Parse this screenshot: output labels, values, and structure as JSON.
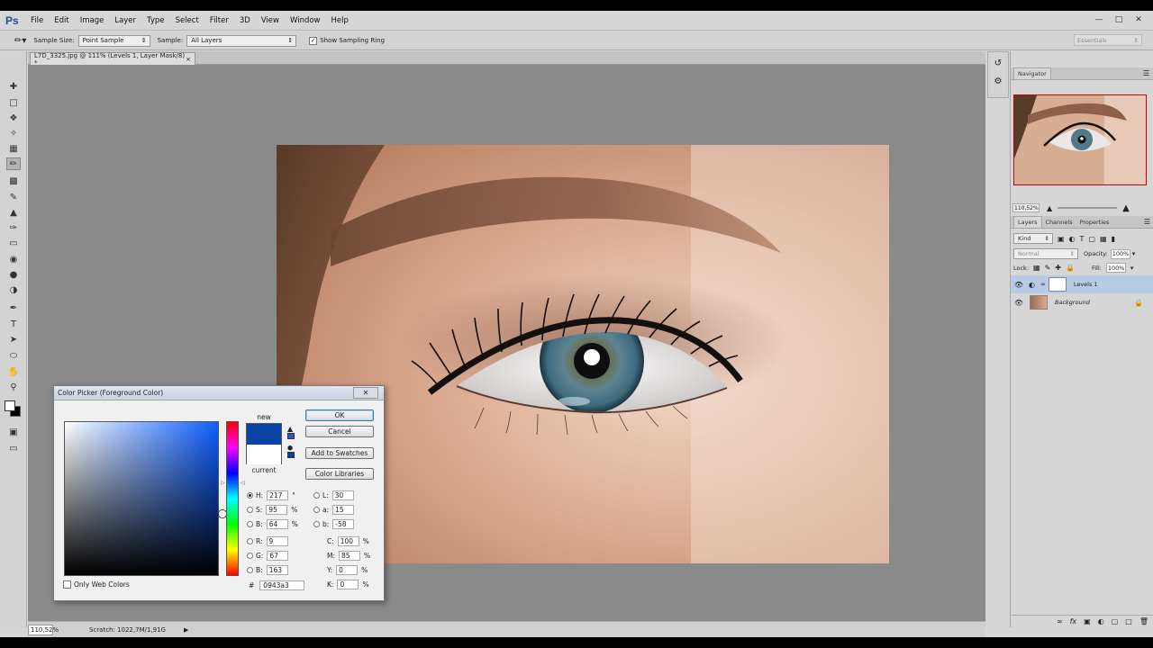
{
  "app": {
    "logo": "Ps",
    "menu": [
      "File",
      "Edit",
      "Image",
      "Layer",
      "Type",
      "Select",
      "Filter",
      "3D",
      "View",
      "Window",
      "Help"
    ]
  },
  "options": {
    "sample_size_label": "Sample Size:",
    "sample_size_value": "Point Sample",
    "sample_label": "Sample:",
    "sample_value": "All Layers",
    "show_ring_label": "Show Sampling Ring",
    "workspace": "Essentials"
  },
  "document": {
    "tab_title": "L7D_3325.jpg @ 111% (Levels 1, Layer Mask/8) *"
  },
  "status": {
    "zoom": "110,52%",
    "scratch": "Scratch: 1022,7M/1,91G"
  },
  "navigator": {
    "title": "Navigator",
    "zoom": "110,52%"
  },
  "layers_panel": {
    "tabs": [
      "Layers",
      "Channels",
      "Properties"
    ],
    "kind_label": "Kind",
    "blend_mode": "Normal",
    "opacity_label": "Opacity:",
    "opacity_value": "100%",
    "lock_label": "Lock:",
    "fill_label": "Fill:",
    "fill_value": "100%",
    "layers": [
      {
        "name": "Levels 1"
      },
      {
        "name": "Background"
      }
    ]
  },
  "color_picker": {
    "title": "Color Picker (Foreground Color)",
    "new_label": "new",
    "current_label": "current",
    "buttons": {
      "ok": "OK",
      "cancel": "Cancel",
      "add_swatches": "Add to Swatches",
      "libraries": "Color Libraries"
    },
    "hsb": {
      "h_label": "H:",
      "h": "217",
      "h_unit": "°",
      "s_label": "S:",
      "s": "95",
      "s_unit": "%",
      "b_label": "B:",
      "b": "64",
      "b_unit": "%"
    },
    "rgb": {
      "r_label": "R:",
      "r": "9",
      "g_label": "G:",
      "g": "67",
      "b_label": "B:",
      "b": "163"
    },
    "lab": {
      "l_label": "L:",
      "l": "30",
      "a_label": "a:",
      "a": "15",
      "b_label": "b:",
      "b": "-58"
    },
    "cmyk": {
      "c_label": "C:",
      "c": "100",
      "m_label": "M:",
      "m": "85",
      "y_label": "Y:",
      "y": "0",
      "k_label": "K:",
      "k": "0",
      "unit": "%"
    },
    "hex_label": "#",
    "hex": "0943a3",
    "web_colors_label": "Only Web Colors",
    "new_color": "#0943a3",
    "current_color": "#ffffff"
  }
}
